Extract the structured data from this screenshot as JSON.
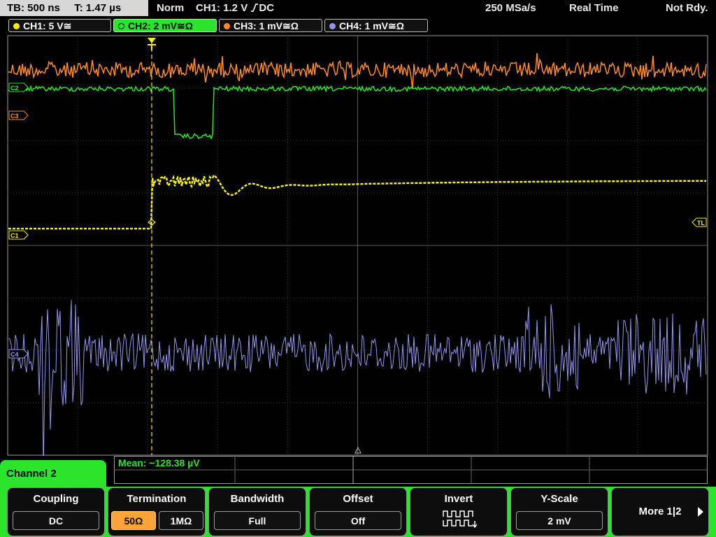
{
  "status": {
    "timebase": "TB: 500 ns",
    "trigger_time": "T: 1.47 µs",
    "trigger_mode": "Norm",
    "trigger_source": "CH1: 1.2 V",
    "trigger_coupling": "DC",
    "sample_rate": "250 MSa/s",
    "acq_mode": "Real Time",
    "ready_state": "Not Rdy."
  },
  "channels": [
    {
      "label": "CH1: 5 V≅",
      "color": "#f4ee1c",
      "active": false,
      "marker": "C1"
    },
    {
      "label": "CH2: 2 mV≅Ω",
      "color": "#2be42b",
      "active": true,
      "marker": "C2"
    },
    {
      "label": "CH3: 1 mV≅Ω",
      "color": "#ff8a2b",
      "active": false,
      "marker": "C3"
    },
    {
      "label": "CH4: 1 mV≅Ω",
      "color": "#9a94f0",
      "active": false,
      "marker": "C4"
    }
  ],
  "markers": {
    "trigger_level": "TL"
  },
  "measurement": {
    "mean": "Mean: −128.38 µV"
  },
  "menu": {
    "title": "Channel 2",
    "coupling": {
      "title": "Coupling",
      "value": "DC"
    },
    "termination": {
      "title": "Termination",
      "option_a": "50Ω",
      "option_b": "1MΩ",
      "selected": "50Ω"
    },
    "bandwidth": {
      "title": "Bandwidth",
      "value": "Full"
    },
    "offset": {
      "title": "Offset",
      "value": "Off"
    },
    "invert": {
      "title": "Invert",
      "icon": "invert-waveform-icon"
    },
    "y_scale": {
      "title": "Y-Scale",
      "value": "2 mV"
    },
    "more": {
      "label": "More 1|2"
    }
  }
}
